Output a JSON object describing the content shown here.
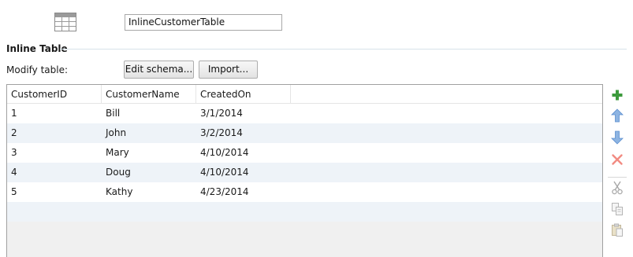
{
  "component": {
    "icon": "table-icon",
    "name_value": "InlineCustomerTable"
  },
  "section": {
    "title": "Inline Table"
  },
  "modify": {
    "label": "Modify table:",
    "edit_schema_label": "Edit schema...",
    "import_label": "Import..."
  },
  "table": {
    "columns": [
      "CustomerID",
      "CustomerName",
      "CreatedOn"
    ],
    "rows": [
      [
        "1",
        "Bill",
        "3/1/2014"
      ],
      [
        "2",
        "John",
        "3/2/2014"
      ],
      [
        "3",
        "Mary",
        "4/10/2014"
      ],
      [
        "4",
        "Doug",
        "4/10/2014"
      ],
      [
        "5",
        "Kathy",
        "4/23/2014"
      ]
    ]
  },
  "toolbar": {
    "icons": [
      "add-icon",
      "move-up-icon",
      "move-down-icon",
      "delete-icon",
      "cut-icon",
      "copy-icon",
      "paste-icon"
    ],
    "colors": {
      "add": "#3c9a3c",
      "arrow": "#5b8fcf",
      "delete": "#e2463a",
      "disabled": "#b9b9b9"
    }
  }
}
